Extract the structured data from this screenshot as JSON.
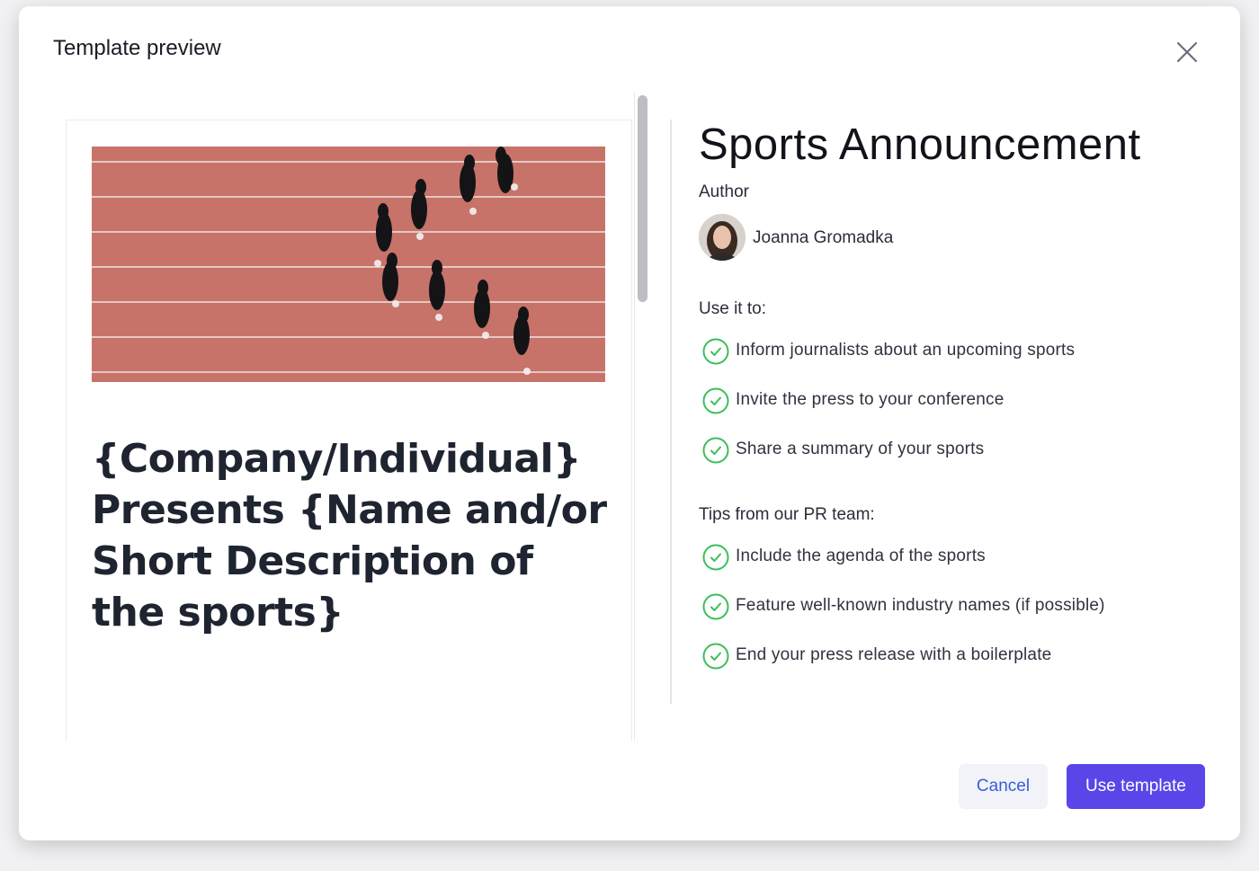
{
  "dialog": {
    "title": "Template preview"
  },
  "preview": {
    "heading": "{Company/Individual} Presents {Name and/or Short Description of the sports}"
  },
  "info": {
    "title": "Sports Announcement",
    "author_label": "Author",
    "author_name": "Joanna Gromadka",
    "use_it_label": "Use it to:",
    "use_it_items": [
      "Inform journalists about an upcoming sports",
      "Invite the press to your conference",
      "Share a summary of your sports"
    ],
    "tips_label": "Tips from our PR team:",
    "tips_items": [
      "Include the agenda of the sports",
      "Feature well-known industry names (if possible)",
      "End your press release with a boilerplate"
    ]
  },
  "footer": {
    "cancel_label": "Cancel",
    "use_template_label": "Use template"
  },
  "colors": {
    "primary": "#5a46e8",
    "check_green": "#3bbf5a",
    "track": "#c8736a"
  },
  "icons": {
    "close": "close-icon",
    "check": "check-circle-icon"
  }
}
